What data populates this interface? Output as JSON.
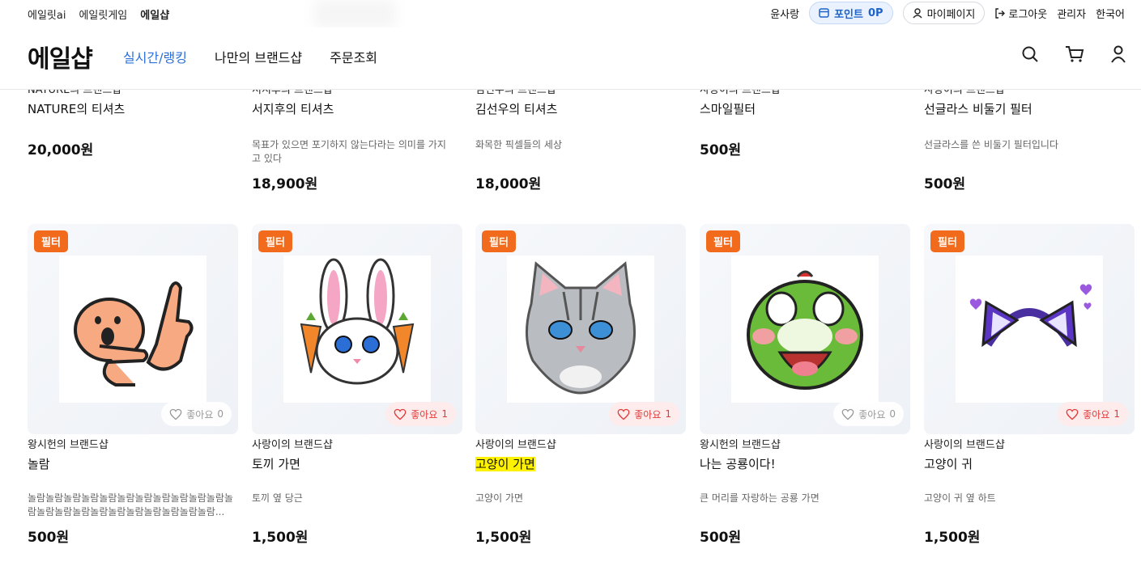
{
  "topbar": {
    "links": [
      "에일릿ai",
      "에일릿게임",
      "에일샵"
    ],
    "user_name": "윤사랑",
    "point_label": "포인트",
    "point_value": "0P",
    "mypage_label": "마이페이지",
    "logout_label": "로그아웃",
    "admin_label": "관리자",
    "language_label": "한국어"
  },
  "header": {
    "logo": "에일샵",
    "nav": [
      "실시간/랭킹",
      "나만의 브랜드샵",
      "주문조회"
    ],
    "active_color": "#2a6fdb"
  },
  "row1": [
    {
      "brand": "NATURE의 브랜드샵",
      "name": "NATURE의 티셔츠",
      "desc": "",
      "price": "20,000원"
    },
    {
      "brand": "서지후의 브랜드샵",
      "name": "서지후의 티셔츠",
      "desc": "목표가 있으면 포기하지 않는다라는 의미를 가지고 있다",
      "price": "18,900원"
    },
    {
      "brand": "김선우의 브랜드샵",
      "name": "김선우의 티셔츠",
      "desc": "화목한 픽셀들의 세상",
      "price": "18,000원"
    },
    {
      "brand": "사랑이의 브랜드샵",
      "name": "스마일필터",
      "desc": "",
      "price": "500원"
    },
    {
      "brand": "사랑이의 브랜드샵",
      "name": "선글라스 비둘기 필터",
      "desc": "선글라스를 쓴 비둘기 필터입니다",
      "price": "500원"
    }
  ],
  "row2": [
    {
      "tag": "필터",
      "like_label": "좋아요",
      "likes": "0",
      "liked": false,
      "brand": "왕시헌의 브랜드샵",
      "name": "놀람",
      "desc": "놀람놀람놀람놀람놀람놀람놀람놀람놀람놀람놀람놀람놀람놀람놀람놀람놀람놀람놀람놀람놀람놀람...",
      "price": "500원",
      "icon": "surprised-hand-icon"
    },
    {
      "tag": "필터",
      "like_label": "좋아요",
      "likes": "1",
      "liked": true,
      "brand": "사랑이의 브랜드샵",
      "name": "토끼 가면",
      "desc": "토끼 옆 당근",
      "price": "1,500원",
      "icon": "rabbit-mask-icon"
    },
    {
      "tag": "필터",
      "like_label": "좋아요",
      "likes": "1",
      "liked": true,
      "brand": "사랑이의 브랜드샵",
      "name": "고양이 가면",
      "desc": "고양이 가면",
      "price": "1,500원",
      "icon": "cat-mask-icon"
    },
    {
      "tag": "필터",
      "like_label": "좋아요",
      "likes": "0",
      "liked": false,
      "brand": "왕시헌의 브랜드샵",
      "name": "나는 공룡이다!",
      "desc": "큰 머리를 자랑하는 공룡 가면",
      "price": "500원",
      "icon": "dinosaur-mask-icon"
    },
    {
      "tag": "필터",
      "like_label": "좋아요",
      "likes": "1",
      "liked": true,
      "brand": "사랑이의 브랜드샵",
      "name": "고양이 귀",
      "desc": "고양이 귀 옆 하트",
      "price": "1,500원",
      "icon": "cat-ears-icon"
    }
  ],
  "colors": {
    "tag_bg": "#f26b1d",
    "liked": "#e03a3a",
    "highlight": "#fff200"
  }
}
